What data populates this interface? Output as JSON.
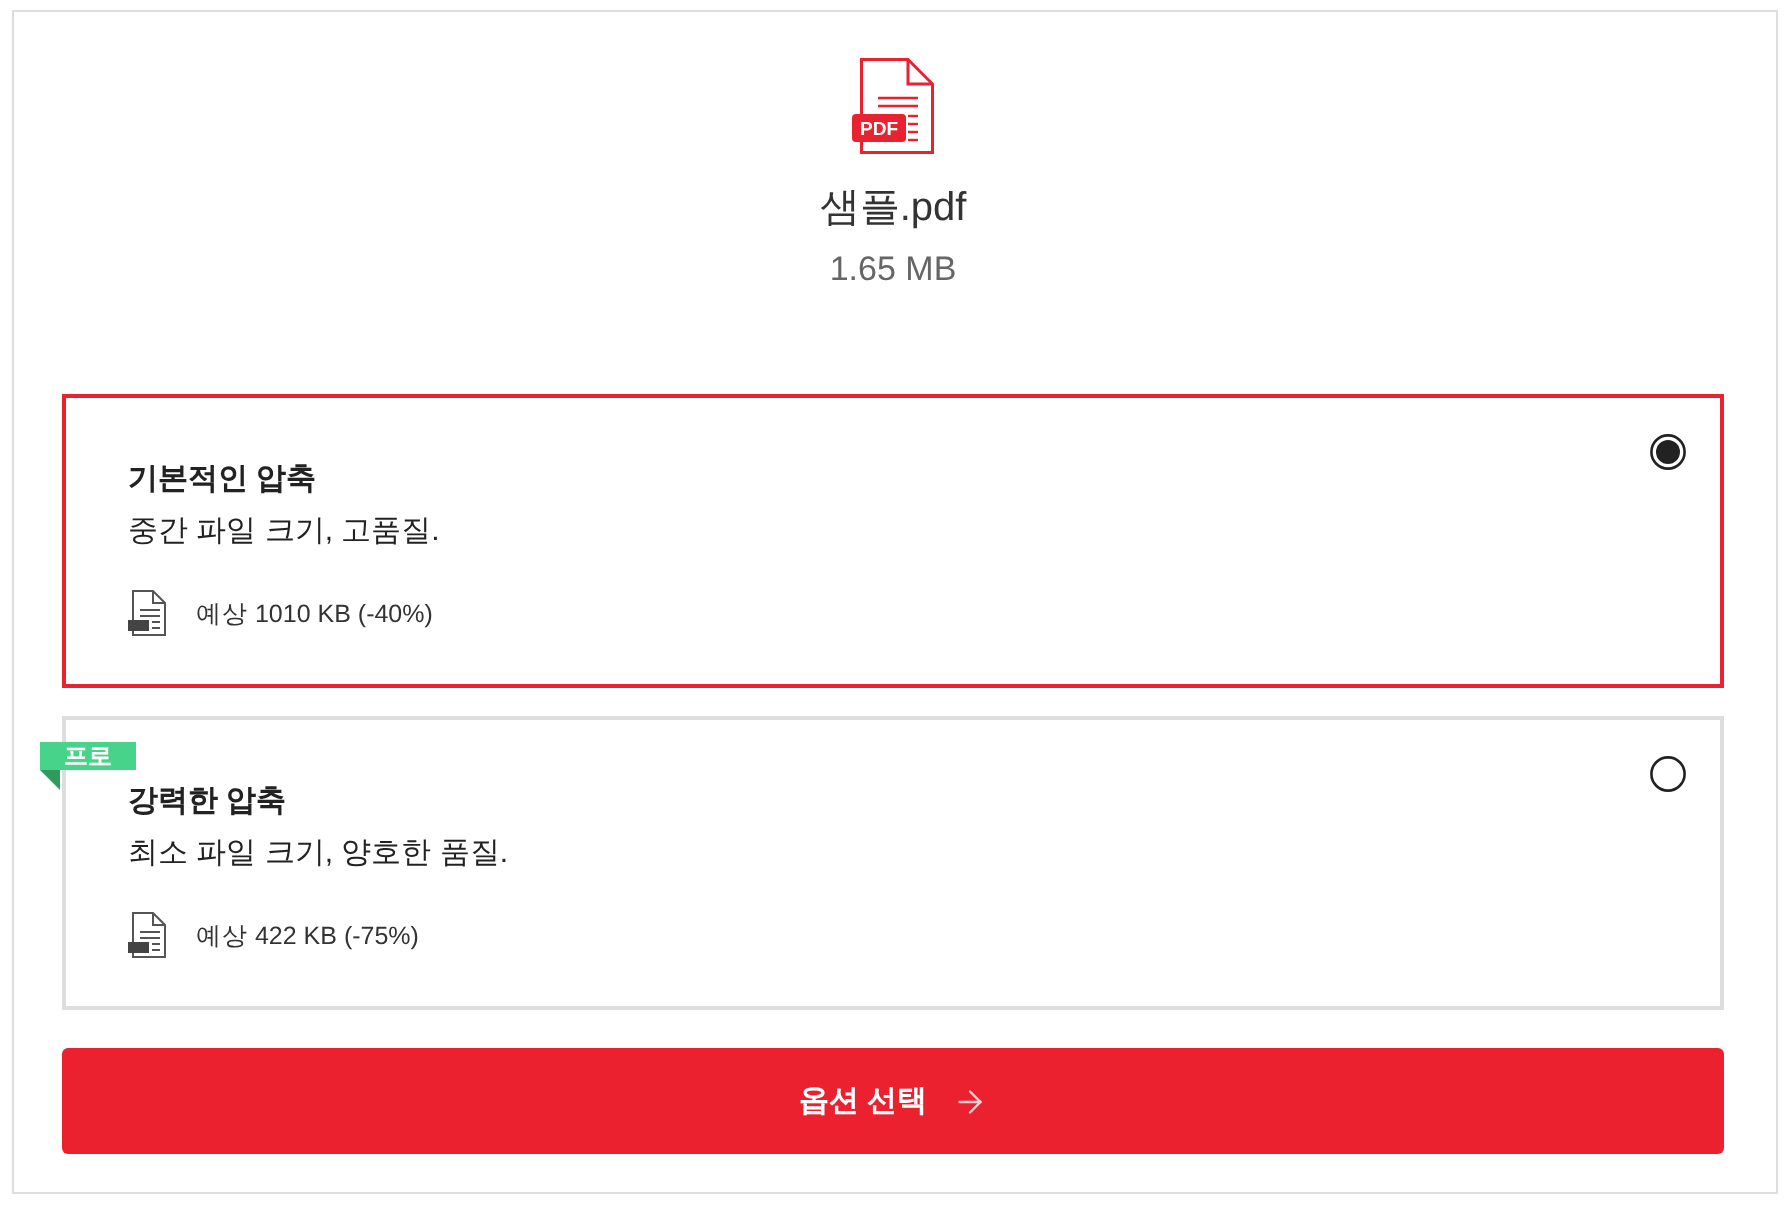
{
  "file": {
    "icon_label": "PDF",
    "name": "샘플.pdf",
    "size": "1.65 MB"
  },
  "options": [
    {
      "title": "기본적인 압축",
      "description": "중간 파일 크기, 고품질.",
      "estimate": "예상 1010 KB (-40%)",
      "selected": true
    },
    {
      "badge": "프로",
      "title": "강력한 압축",
      "description": "최소 파일 크기, 양호한 품질.",
      "estimate": "예상 422 KB (-75%)",
      "selected": false
    }
  ],
  "button": {
    "label": "옵션 선택"
  }
}
